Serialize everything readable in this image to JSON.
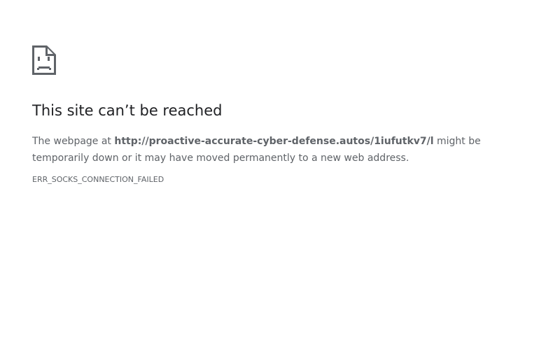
{
  "page": {
    "icon": "sad-page-icon",
    "title": "This site can’t be reached",
    "message": {
      "prefix": "The webpage at ",
      "url": "http://proactive-accurate-cyber-defense.autos/1iufutkv7/l",
      "suffix": " might be temporarily down or it may have moved permanently to a new web address."
    },
    "error_code": "ERR_SOCKS_CONNECTION_FAILED"
  },
  "colors": {
    "title": "#202124",
    "text": "#5f6368",
    "background": "#ffffff"
  }
}
